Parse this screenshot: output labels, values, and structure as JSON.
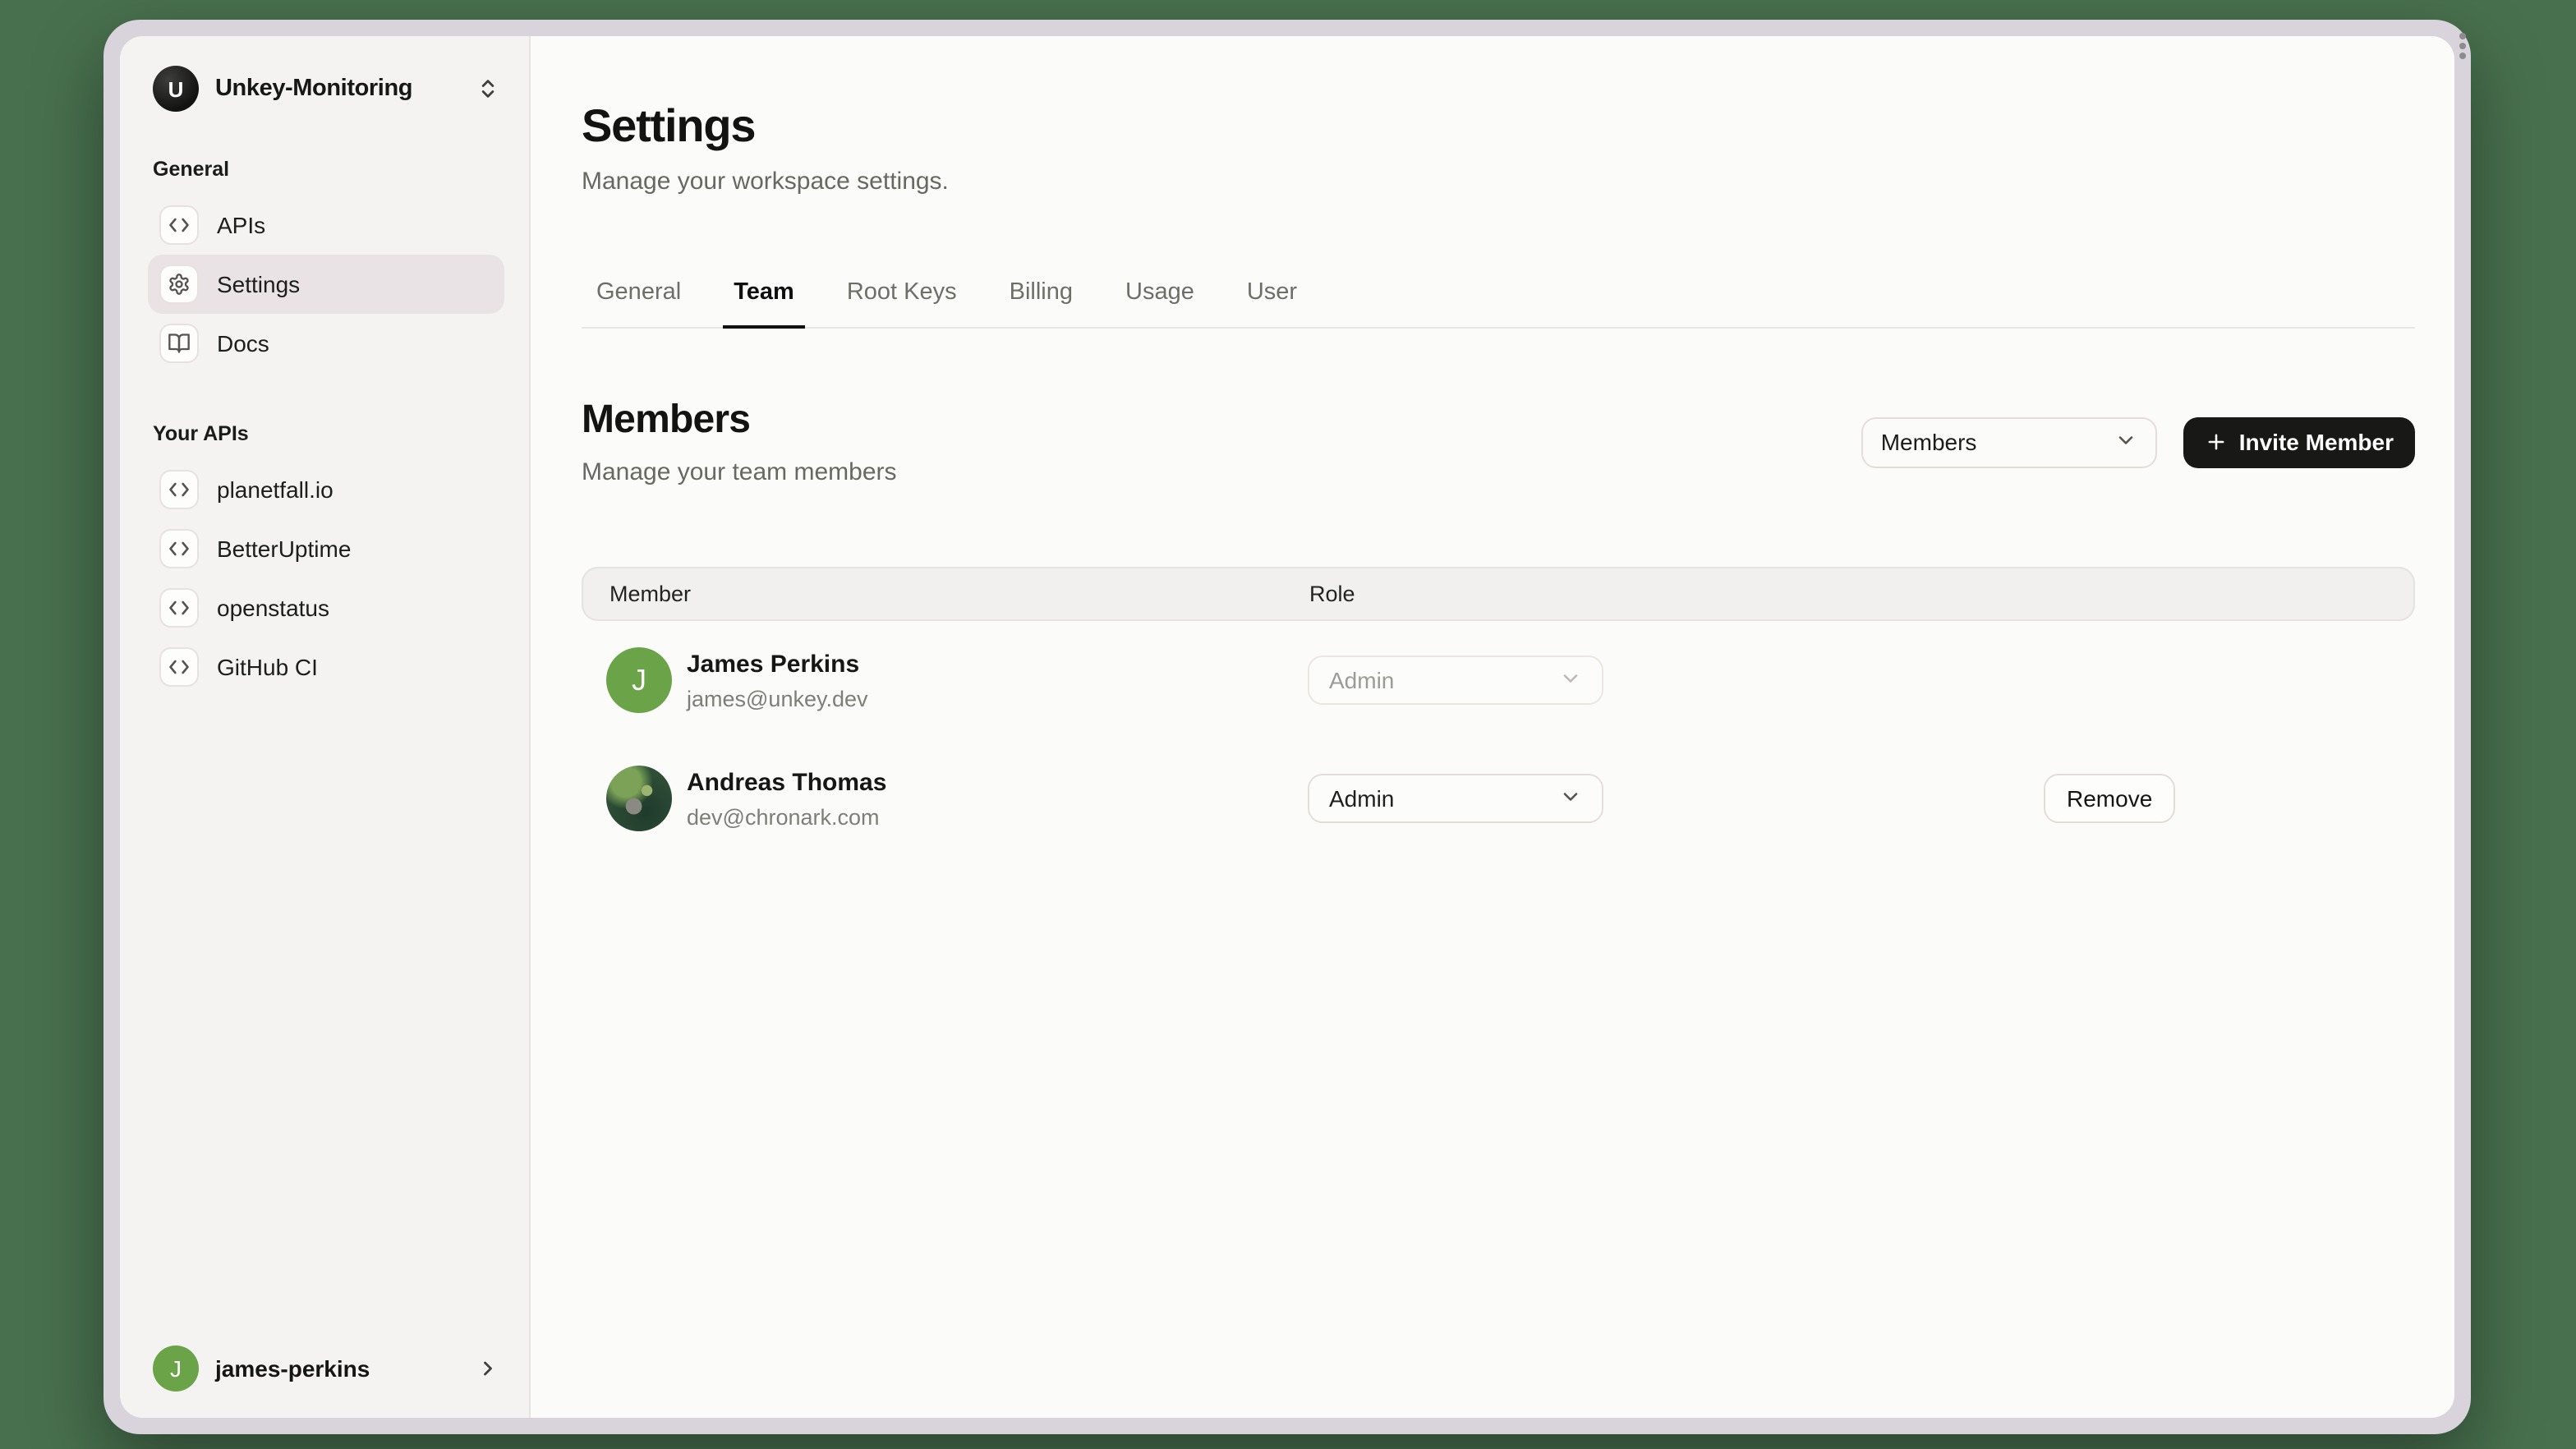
{
  "sidebar": {
    "workspace": {
      "name": "Unkey-Monitoring",
      "initial": "U"
    },
    "general_label": "General",
    "general_items": [
      {
        "label": "APIs",
        "icon": "code-icon"
      },
      {
        "label": "Settings",
        "icon": "gear-icon",
        "active": true
      },
      {
        "label": "Docs",
        "icon": "book-icon"
      }
    ],
    "apis_label": "Your APIs",
    "api_items": [
      {
        "label": "planetfall.io",
        "icon": "code-icon"
      },
      {
        "label": "BetterUptime",
        "icon": "code-icon"
      },
      {
        "label": "openstatus",
        "icon": "code-icon"
      },
      {
        "label": "GitHub CI",
        "icon": "code-icon"
      }
    ],
    "user": {
      "name": "james-perkins",
      "initial": "J"
    }
  },
  "header": {
    "title": "Settings",
    "subtitle": "Manage your workspace settings."
  },
  "tabs": {
    "active": "Team",
    "items": [
      {
        "label": "General"
      },
      {
        "label": "Team"
      },
      {
        "label": "Root Keys"
      },
      {
        "label": "Billing"
      },
      {
        "label": "Usage"
      },
      {
        "label": "User"
      }
    ]
  },
  "members": {
    "title": "Members",
    "subtitle": "Manage your team members",
    "filter": {
      "value": "Members"
    },
    "invite_button": {
      "label": "Invite Member"
    },
    "table": {
      "columns": {
        "member": "Member",
        "role": "Role"
      },
      "rows": [
        {
          "name": "James Perkins",
          "email": "james@unkey.dev",
          "initial": "J",
          "role": "Admin",
          "role_editable": false
        },
        {
          "name": "Andreas Thomas",
          "email": "dev@chronark.com",
          "role": "Admin",
          "role_editable": true,
          "remove_label": "Remove"
        }
      ]
    }
  },
  "colors": {
    "canvas_background": "#48704e",
    "window_frame": "#d9d3dc",
    "app_background": "#fbfbfa",
    "sidebar_background": "#f4f3f1",
    "active_item_background": "#e9e3e6",
    "avatar_green": "#6aa348",
    "invite_button_background": "#181816"
  }
}
